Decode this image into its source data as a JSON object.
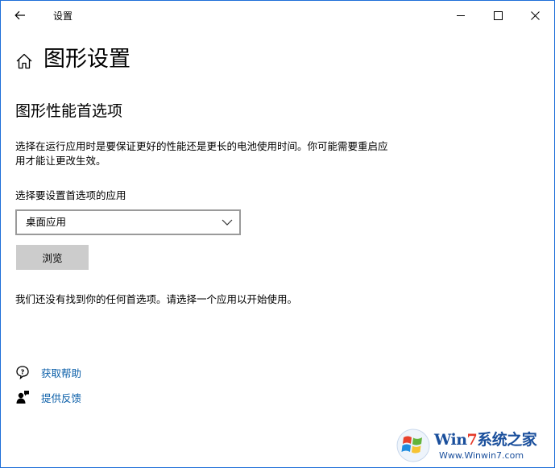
{
  "window": {
    "title": "设置",
    "controls": [
      "minimize",
      "maximize",
      "close"
    ]
  },
  "header": {
    "title": "图形设置",
    "home_icon": "home-icon"
  },
  "section": {
    "title": "图形性能首选项",
    "description": "选择在运行应用时是要保证更好的性能还是更长的电池使用时间。你可能需要重启应用才能让更改生效。"
  },
  "app_select": {
    "label": "选择要设置首选项的应用",
    "selected": "桌面应用"
  },
  "browse": {
    "label": "浏览"
  },
  "empty_message": "我们还没有找到你的任何首选项。请选择一个应用以开始使用。",
  "links": [
    {
      "label": "获取帮助",
      "icon": "help-chat-icon"
    },
    {
      "label": "提供反馈",
      "icon": "feedback-person-icon"
    }
  ],
  "watermark": {
    "brand_prefix": "Win",
    "brand_seven": "7",
    "brand_suffix": "系统之家",
    "url": "Www.Winwin7.com"
  },
  "colors": {
    "accent_link": "#0a5ea8",
    "window_border": "#1e6fd8",
    "button_bg": "#cccccc"
  }
}
